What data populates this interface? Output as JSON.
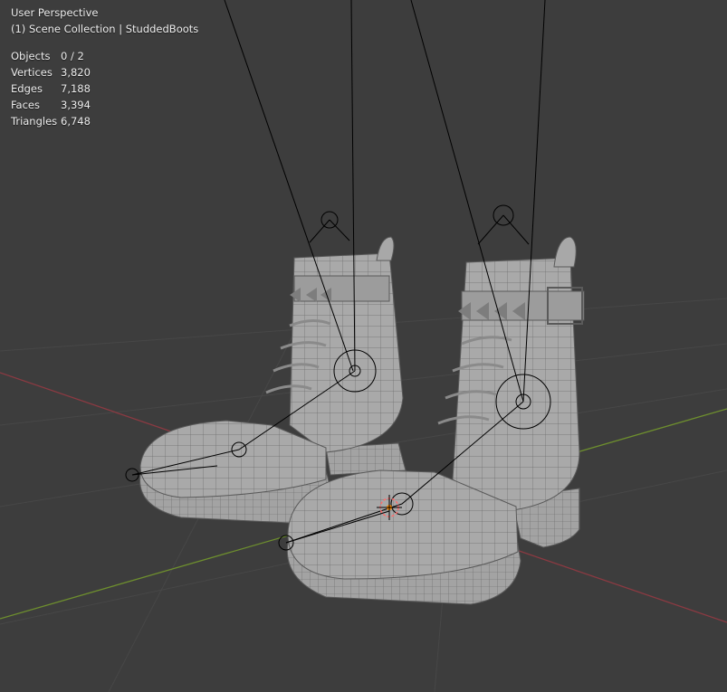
{
  "viewport": {
    "view_name": "User Perspective",
    "collection_info": "(1) Scene Collection | StuddedBoots",
    "background_color": "#3d3d3d"
  },
  "stats": [
    {
      "label": "Objects",
      "value": "0 / 2"
    },
    {
      "label": "Vertices",
      "value": "3,820"
    },
    {
      "label": "Edges",
      "value": "7,188"
    },
    {
      "label": "Faces",
      "value": "3,394"
    },
    {
      "label": "Triangles",
      "value": "6,748"
    }
  ],
  "colors": {
    "grid_line": "#4a4a4a",
    "x_axis": "#8b3a42",
    "y_axis": "#6e8f2e",
    "mesh_fill": "#a6a6a6",
    "mesh_wire": "#5e5e5e",
    "rig_line": "#000000",
    "origin_marker": "#ff8c00"
  },
  "icons": {
    "object_origin": "origin-marker-icon",
    "bone_joint": "bone-joint-icon"
  }
}
